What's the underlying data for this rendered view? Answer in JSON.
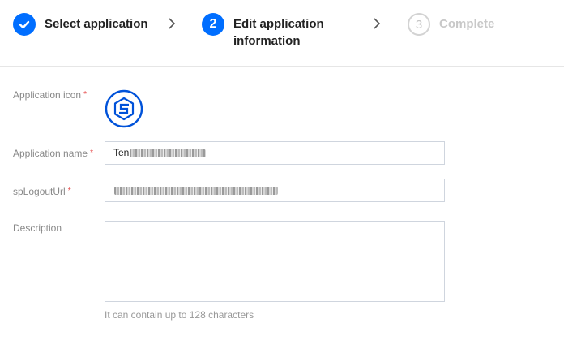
{
  "steps": [
    {
      "number": "",
      "label": "Select application",
      "state": "done"
    },
    {
      "number": "2",
      "label": "Edit application information",
      "state": "active"
    },
    {
      "number": "3",
      "label": "Complete",
      "state": "pending"
    }
  ],
  "form": {
    "icon_label": "Application icon",
    "name_label": "Application name",
    "name_value": "Ten",
    "logout_label": "spLogoutUrl",
    "description_label": "Description",
    "description_value": "",
    "description_hint": "It can contain up to 128 characters",
    "required_mark": "*"
  },
  "colors": {
    "accent": "#006eff",
    "required": "#e54545"
  },
  "icons": [
    "check-icon",
    "chevron-right-icon",
    "application-logo-icon"
  ]
}
